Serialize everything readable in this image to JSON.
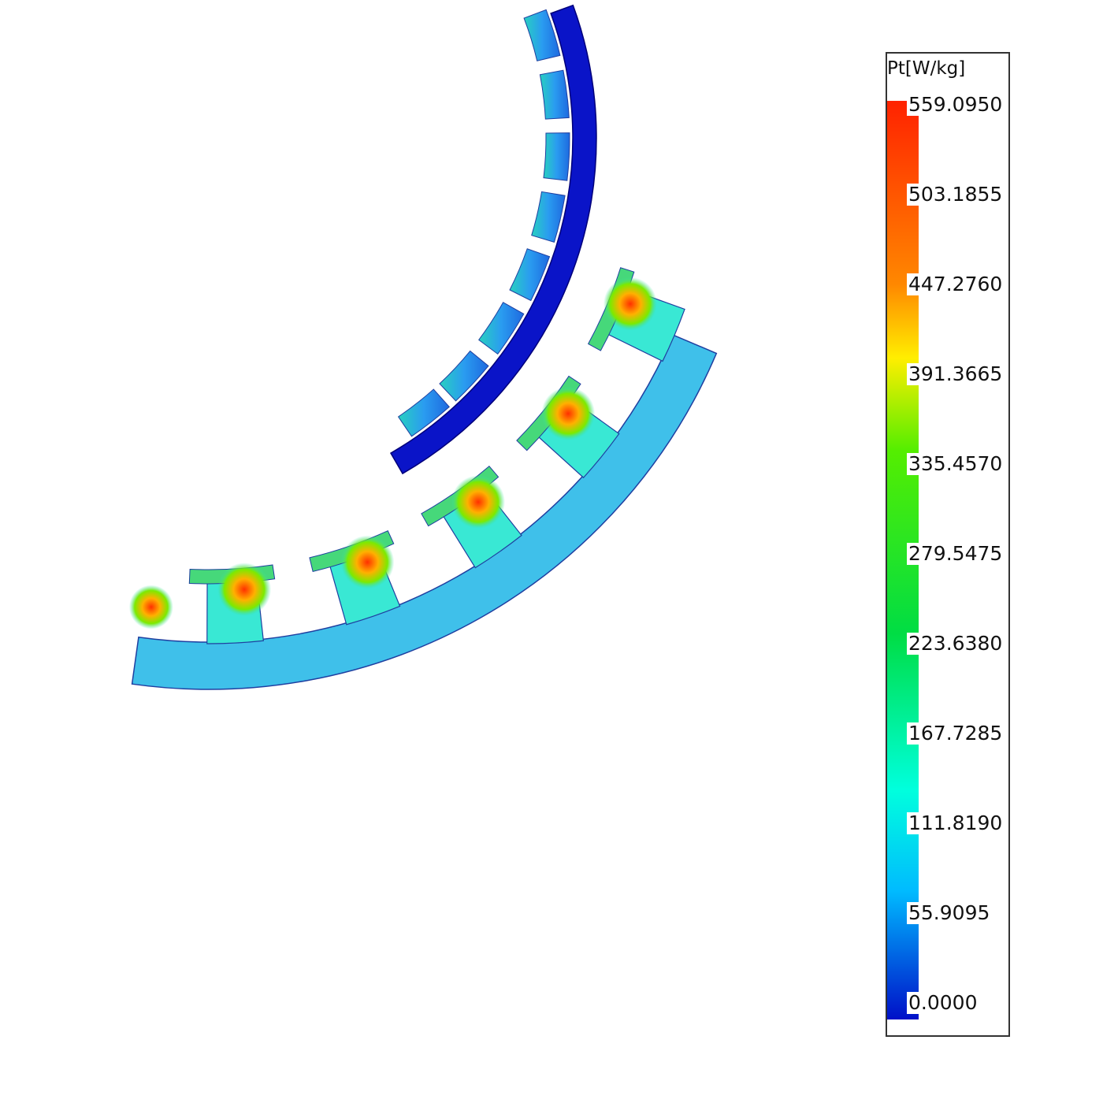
{
  "legend": {
    "title": "Pt[W/kg]",
    "labels": [
      "559.0950",
      "503.1855",
      "447.2760",
      "391.3665",
      "335.4570",
      "279.5475",
      "223.6380",
      "167.7285",
      "111.8190",
      "55.9095",
      "0.0000"
    ],
    "colors": {
      "max": "#ff2200",
      "high": "#ff8800",
      "upper": "#ffee00",
      "mid_high": "#55ee00",
      "mid": "#00dd44",
      "lower": "#00ffdd",
      "low": "#00bbff",
      "min": "#0010c8"
    }
  },
  "plot": {
    "stator_core_color": "#39e8d4",
    "stator_yoke_color": "#3fc0ea",
    "hotspot_color": "#ff4010",
    "rotor_color": "#0a14c8",
    "magnet_color": "#2aa6ee"
  }
}
